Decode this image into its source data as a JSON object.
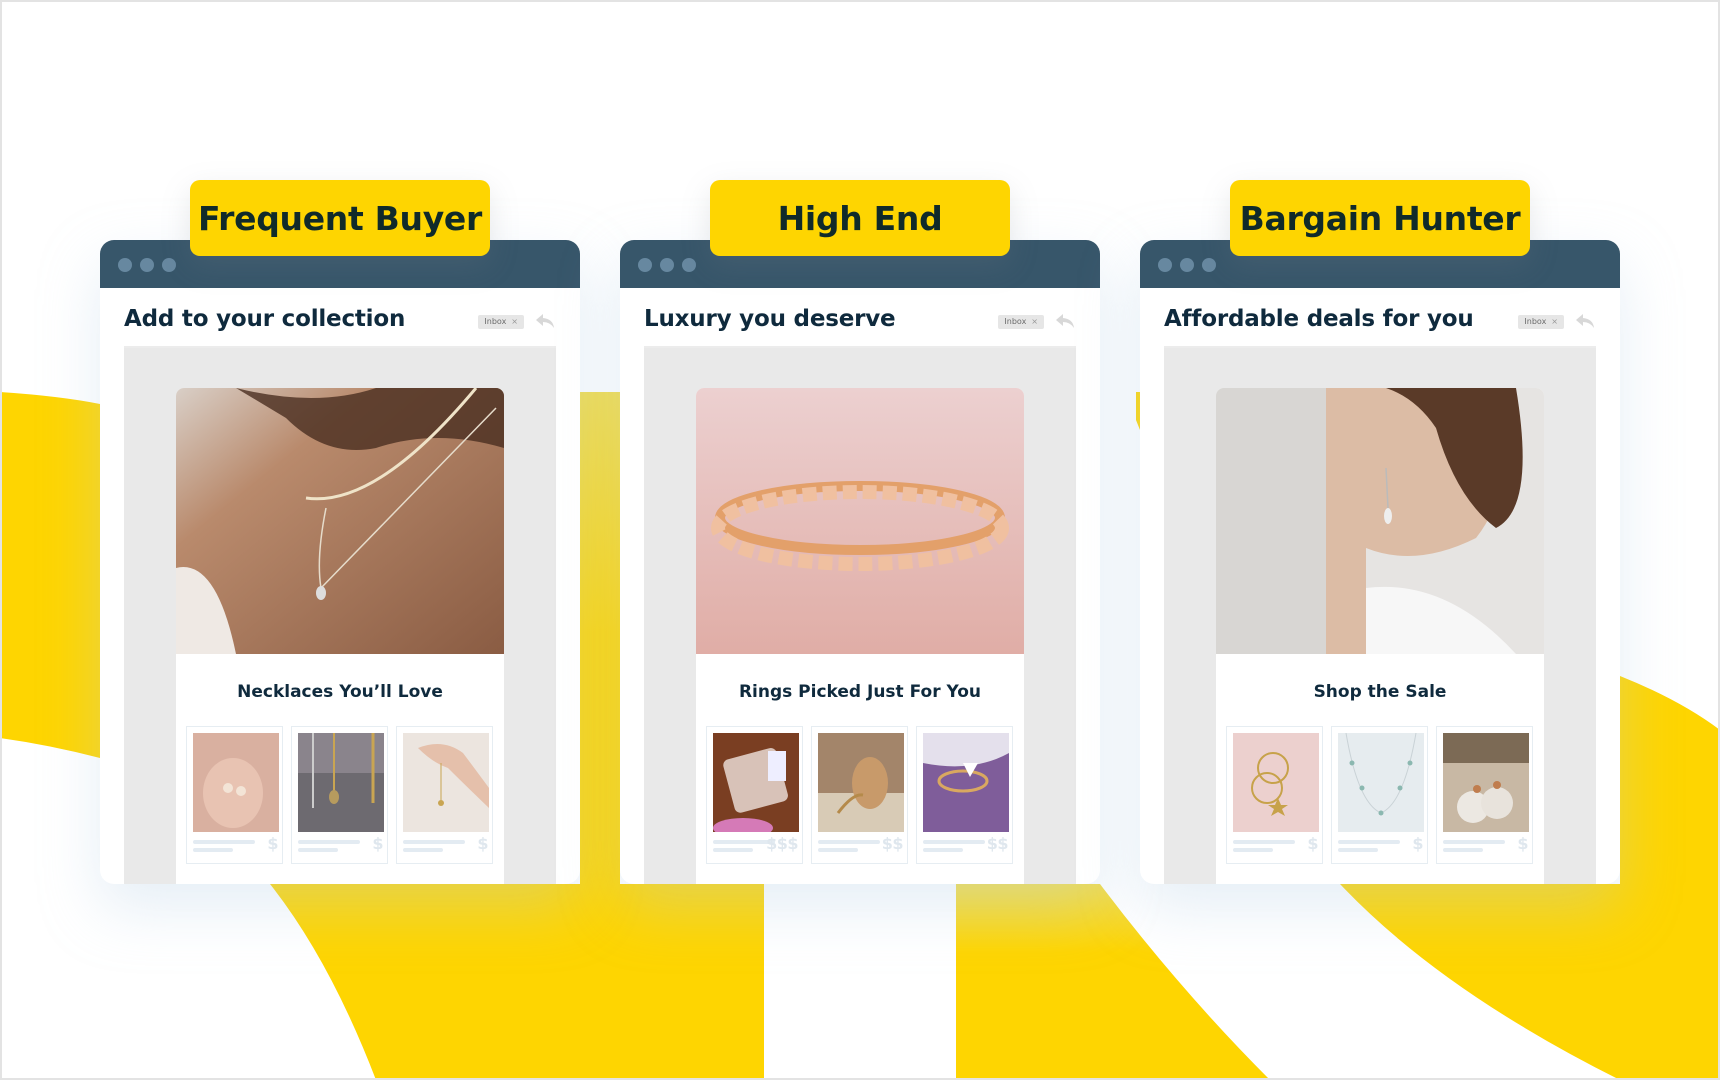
{
  "colors": {
    "accent_yellow": "#fed501",
    "titlebar": "#37566a",
    "text_dark": "#0f2a3d",
    "email_bg": "#e9e9e9"
  },
  "segments": [
    {
      "tag": "Frequent Buyer",
      "subject": "Add to your collection",
      "inbox_label": "Inbox",
      "inbox_close": "×",
      "hero": "woman wearing layered gold necklaces",
      "section_title": "Necklaces You’ll Love",
      "products": [
        {
          "image": "hand holding delicate pendant necklaces",
          "price": "$"
        },
        {
          "image": "hanging pendant necklaces",
          "price": "$"
        },
        {
          "image": "hand holding thin chain",
          "price": "$"
        }
      ]
    },
    {
      "tag": "High End",
      "subject": "Luxury you deserve",
      "inbox_label": "Inbox",
      "inbox_close": "×",
      "hero": "rose gold diamond bangle on pink background",
      "section_title": "Rings Picked Just For You",
      "products": [
        {
          "image": "stacked diamond rings",
          "price": "$$$"
        },
        {
          "image": "cluster cocktail ring",
          "price": "$$"
        },
        {
          "image": "gold ring on amethyst",
          "price": "$$"
        }
      ]
    },
    {
      "tag": "Bargain Hunter",
      "subject": "Affordable deals for you",
      "inbox_label": "Inbox",
      "inbox_close": "×",
      "hero": "woman wearing drop earring",
      "section_title": "Shop the Sale",
      "products": [
        {
          "image": "gold hoop earrings with stars",
          "price": "$"
        },
        {
          "image": "dainty charm necklace",
          "price": "$"
        },
        {
          "image": "round white disc earrings",
          "price": "$"
        }
      ]
    }
  ]
}
